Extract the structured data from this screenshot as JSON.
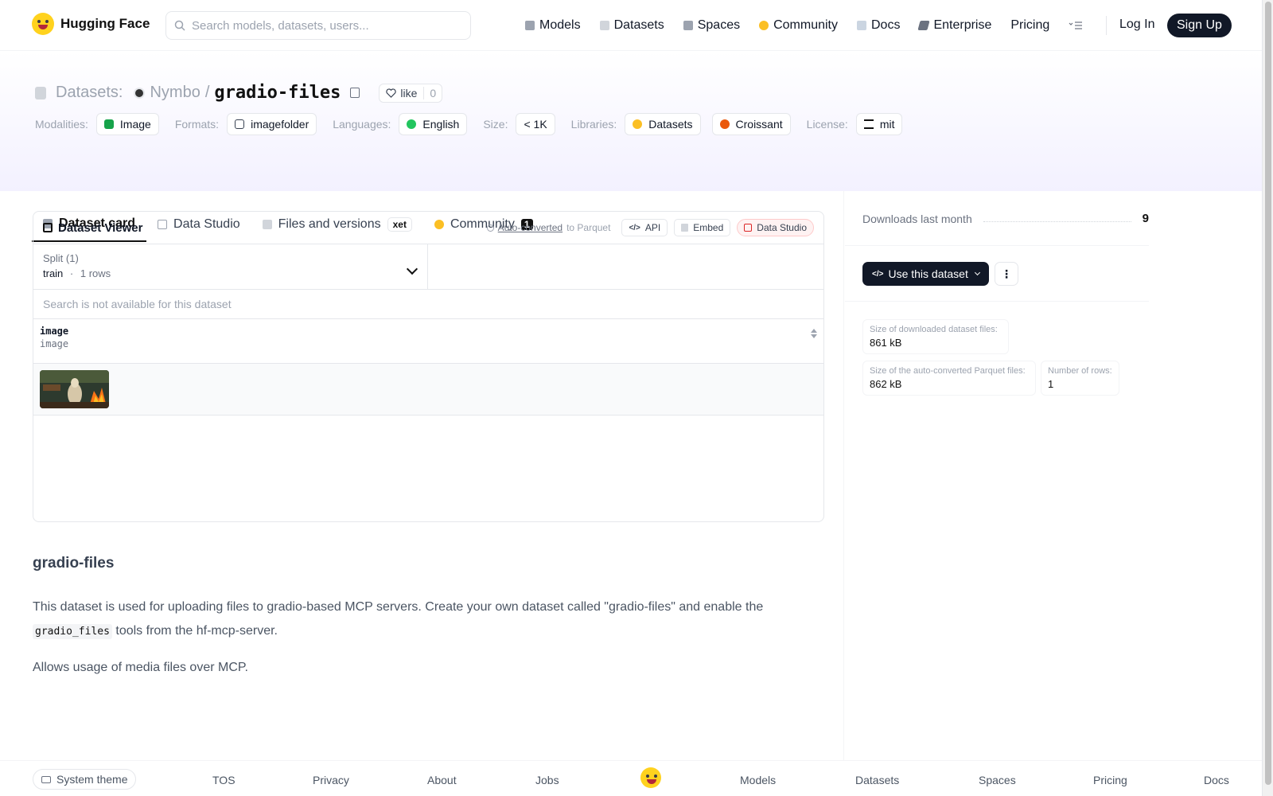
{
  "brand": {
    "name": "Hugging Face"
  },
  "search": {
    "placeholder": "Search models, datasets, users..."
  },
  "nav": {
    "items": [
      {
        "label": "Models",
        "icon": "cube-icon"
      },
      {
        "label": "Datasets",
        "icon": "database-icon"
      },
      {
        "label": "Spaces",
        "icon": "grid-icon"
      },
      {
        "label": "Community",
        "icon": "community-icon"
      },
      {
        "label": "Docs",
        "icon": "book-icon"
      },
      {
        "label": "Enterprise",
        "icon": "enterprise-icon"
      },
      {
        "label": "Pricing",
        "icon": ""
      }
    ],
    "login": "Log In",
    "signup": "Sign Up"
  },
  "header": {
    "section": "Datasets:",
    "owner": "Nymbo",
    "separator": "/",
    "dataset": "gradio-files",
    "like_label": "like",
    "like_count": "0"
  },
  "tags": [
    {
      "label": "Modalities:",
      "value": "Image",
      "icon_color": "#16a34a"
    },
    {
      "label": "Formats:",
      "value": "imagefolder",
      "icon_color": "#374151"
    },
    {
      "label": "Languages:",
      "value": "English",
      "icon_color": "#22c55e"
    },
    {
      "label": "Size:",
      "value": "< 1K",
      "icon_color": ""
    },
    {
      "label": "Libraries:",
      "value": "Datasets",
      "icon_color": "#fbbf24"
    },
    {
      "label": "",
      "value": "Croissant",
      "icon_color": "#ea580c"
    },
    {
      "label": "License:",
      "value": "mit",
      "icon_color": "#111827"
    }
  ],
  "tabs": [
    {
      "label": "Dataset card",
      "active": true
    },
    {
      "label": "Data Studio",
      "active": false
    },
    {
      "label": "Files and versions",
      "badge": "xet",
      "active": false
    },
    {
      "label": "Community",
      "badge": "1",
      "active": false
    }
  ],
  "viewer": {
    "title": "Dataset Viewer",
    "auto_converted": "Auto-converted",
    "to_parquet": "to Parquet",
    "api": "API",
    "embed": "Embed",
    "data_studio": "Data Studio",
    "split_label": "Split (1)",
    "split_name": "train",
    "split_dot": "·",
    "split_rows": "1 rows",
    "search_na": "Search is not available for this dataset",
    "column": {
      "name": "image",
      "type": "image"
    }
  },
  "card": {
    "title": "gradio-files",
    "p1_before": "This dataset is used for uploading files to gradio-based MCP servers. Create your own dataset called \"gradio-files\" and enable the",
    "p1_code": "gradio_files",
    "p1_after": "tools from the hf-mcp-server.",
    "p2": "Allows usage of media files over MCP."
  },
  "sidebar": {
    "downloads_label": "Downloads last month",
    "downloads_value": "9",
    "use_dataset": "Use this dataset",
    "stats": [
      {
        "label": "Size of downloaded dataset files:",
        "value": "861 kB"
      },
      {
        "label": "Size of the auto-converted Parquet files:",
        "value": "862 kB"
      },
      {
        "label": "Number of rows:",
        "value": "1"
      }
    ]
  },
  "footer": {
    "theme": "System theme",
    "links": [
      "TOS",
      "Privacy",
      "About",
      "Jobs",
      "Models",
      "Datasets",
      "Spaces",
      "Pricing",
      "Docs"
    ]
  }
}
